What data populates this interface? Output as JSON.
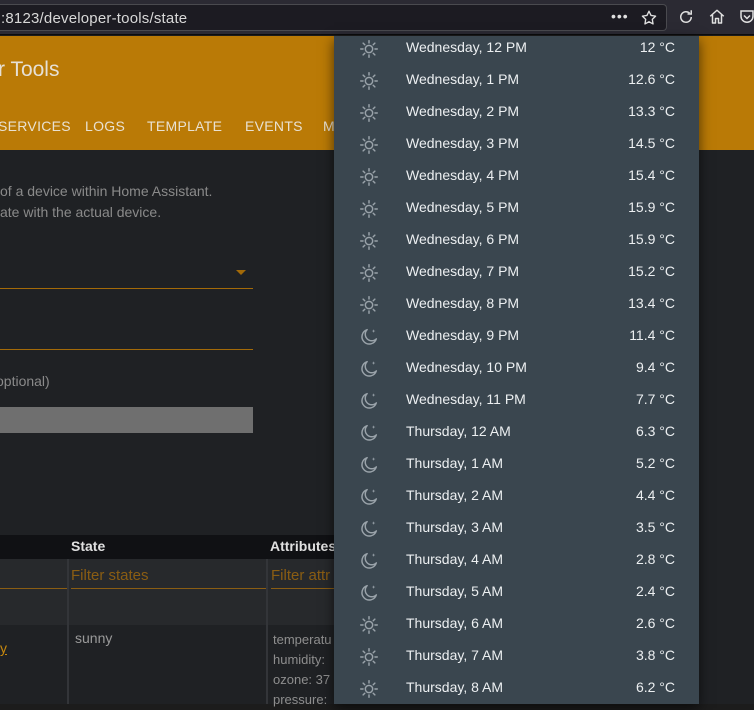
{
  "browser": {
    "url": ":8123/developer-tools/state",
    "more_icon": "•••"
  },
  "app": {
    "title": "r Tools",
    "tabs": [
      "SERVICES",
      "LOGS",
      "TEMPLATE",
      "EVENTS",
      "M"
    ]
  },
  "description": {
    "line1": "of a device within Home Assistant.",
    "line2": "ate with the actual device."
  },
  "form": {
    "attributes_label": "optional)"
  },
  "table": {
    "headers": {
      "state": "State",
      "attributes": "Attributes"
    },
    "filters": {
      "state": "Filter states",
      "attributes": "Filter attr"
    },
    "row": {
      "entity": "y",
      "state": "sunny",
      "attributes": [
        "temperatu",
        "humidity:",
        "ozone: 37",
        "pressure:"
      ]
    }
  },
  "forecast": [
    {
      "label": "Wednesday, 12 PM",
      "temp": "12 °C",
      "icon": "sunny"
    },
    {
      "label": "Wednesday, 1 PM",
      "temp": "12.6 °C",
      "icon": "sunny"
    },
    {
      "label": "Wednesday, 2 PM",
      "temp": "13.3 °C",
      "icon": "sunny"
    },
    {
      "label": "Wednesday, 3 PM",
      "temp": "14.5 °C",
      "icon": "sunny"
    },
    {
      "label": "Wednesday, 4 PM",
      "temp": "15.4 °C",
      "icon": "sunny"
    },
    {
      "label": "Wednesday, 5 PM",
      "temp": "15.9 °C",
      "icon": "sunny"
    },
    {
      "label": "Wednesday, 6 PM",
      "temp": "15.9 °C",
      "icon": "sunny"
    },
    {
      "label": "Wednesday, 7 PM",
      "temp": "15.2 °C",
      "icon": "sunny"
    },
    {
      "label": "Wednesday, 8 PM",
      "temp": "13.4 °C",
      "icon": "sunny"
    },
    {
      "label": "Wednesday, 9 PM",
      "temp": "11.4 °C",
      "icon": "night"
    },
    {
      "label": "Wednesday, 10 PM",
      "temp": "9.4 °C",
      "icon": "night"
    },
    {
      "label": "Wednesday, 11 PM",
      "temp": "7.7 °C",
      "icon": "night"
    },
    {
      "label": "Thursday, 12 AM",
      "temp": "6.3 °C",
      "icon": "night"
    },
    {
      "label": "Thursday, 1 AM",
      "temp": "5.2 °C",
      "icon": "night"
    },
    {
      "label": "Thursday, 2 AM",
      "temp": "4.4 °C",
      "icon": "night"
    },
    {
      "label": "Thursday, 3 AM",
      "temp": "3.5 °C",
      "icon": "night"
    },
    {
      "label": "Thursday, 4 AM",
      "temp": "2.8 °C",
      "icon": "night"
    },
    {
      "label": "Thursday, 5 AM",
      "temp": "2.4 °C",
      "icon": "night"
    },
    {
      "label": "Thursday, 6 AM",
      "temp": "2.6 °C",
      "icon": "sunny"
    },
    {
      "label": "Thursday, 7 AM",
      "temp": "3.8 °C",
      "icon": "sunny"
    },
    {
      "label": "Thursday, 8 AM",
      "temp": "6.2 °C",
      "icon": "sunny"
    }
  ]
}
